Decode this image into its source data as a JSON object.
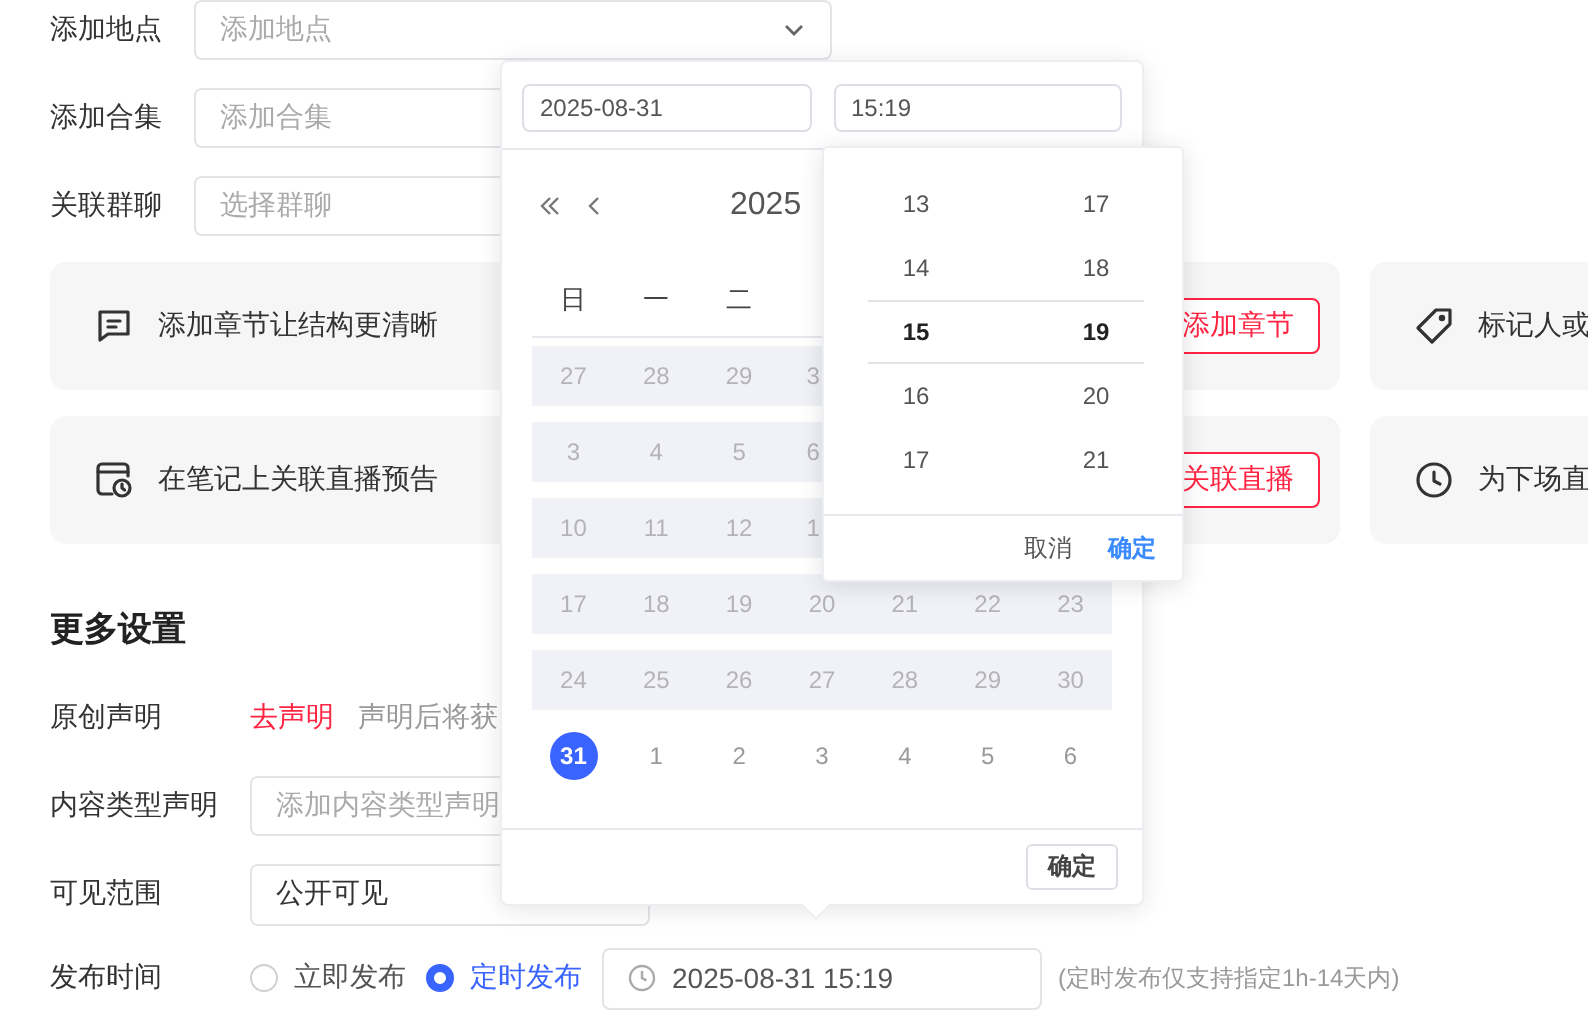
{
  "top_fields": [
    {
      "label": "添加地点",
      "placeholder": "添加地点",
      "kind": "select"
    },
    {
      "label": "添加合集",
      "placeholder": "添加合集",
      "kind": "input"
    },
    {
      "label": "关联群聊",
      "placeholder": "选择群聊",
      "kind": "input"
    }
  ],
  "feature_cards": [
    {
      "text": "添加章节让结构更清晰",
      "button": "添加章节"
    },
    {
      "text": "标记人或"
    },
    {
      "text": "在笔记上关联直播预告",
      "button": "关联直播"
    },
    {
      "text": "为下场直"
    }
  ],
  "more_settings": {
    "title": "更多设置",
    "original": {
      "label": "原创声明",
      "link": "去声明",
      "hint": "声明后将获"
    },
    "content_type": {
      "label": "内容类型声明",
      "placeholder": "添加内容类型声明"
    },
    "visibility": {
      "label": "可见范围",
      "value": "公开可见"
    },
    "publish": {
      "label": "发布时间",
      "options": [
        {
          "label": "立即发布",
          "selected": false
        },
        {
          "label": "定时发布",
          "selected": true
        }
      ],
      "value": "2025-08-31 15:19",
      "note": "(定时发布仅支持指定1h-14天内)"
    }
  },
  "date_popover": {
    "date_value": "2025-08-31",
    "time_value": "15:19",
    "month_title": "2025",
    "weekdays": [
      "日",
      "一",
      "二"
    ],
    "weeks": [
      {
        "disabled": true,
        "days": [
          {
            "label": "27",
            "selected": false
          },
          {
            "label": "28",
            "selected": false
          },
          {
            "label": "29",
            "selected": false
          },
          {
            "label": "3",
            "selected": false
          }
        ]
      },
      {
        "disabled": true,
        "days": [
          {
            "label": "3",
            "selected": false
          },
          {
            "label": "4",
            "selected": false
          },
          {
            "label": "5",
            "selected": false
          },
          {
            "label": "6",
            "selected": false
          }
        ]
      },
      {
        "disabled": true,
        "days": [
          {
            "label": "10",
            "selected": false
          },
          {
            "label": "11",
            "selected": false
          },
          {
            "label": "12",
            "selected": false
          },
          {
            "label": "1",
            "selected": false
          }
        ]
      },
      {
        "disabled": true,
        "days": [
          {
            "label": "17",
            "selected": false
          },
          {
            "label": "18",
            "selected": false
          },
          {
            "label": "19",
            "selected": false
          },
          {
            "label": "20",
            "selected": false
          },
          {
            "label": "21",
            "selected": false
          },
          {
            "label": "22",
            "selected": false
          },
          {
            "label": "23",
            "selected": false
          }
        ]
      },
      {
        "disabled": true,
        "days": [
          {
            "label": "24",
            "selected": false
          },
          {
            "label": "25",
            "selected": false
          },
          {
            "label": "26",
            "selected": false
          },
          {
            "label": "27",
            "selected": false
          },
          {
            "label": "28",
            "selected": false
          },
          {
            "label": "29",
            "selected": false
          },
          {
            "label": "30",
            "selected": false
          }
        ]
      },
      {
        "disabled": false,
        "days": [
          {
            "label": "31",
            "selected": true
          },
          {
            "label": "1",
            "selected": false
          },
          {
            "label": "2",
            "selected": false
          },
          {
            "label": "3",
            "selected": false
          },
          {
            "label": "4",
            "selected": false
          },
          {
            "label": "5",
            "selected": false
          },
          {
            "label": "6",
            "selected": false
          }
        ]
      }
    ],
    "confirm": "确定"
  },
  "time_picker": {
    "hours": [
      {
        "label": "13",
        "selected": false
      },
      {
        "label": "14",
        "selected": false
      },
      {
        "label": "15",
        "selected": true
      },
      {
        "label": "16",
        "selected": false
      },
      {
        "label": "17",
        "selected": false
      }
    ],
    "minutes": [
      {
        "label": "17",
        "selected": false
      },
      {
        "label": "18",
        "selected": false
      },
      {
        "label": "19",
        "selected": true
      },
      {
        "label": "20",
        "selected": false
      },
      {
        "label": "21",
        "selected": false
      }
    ],
    "cancel": "取消",
    "confirm": "确定"
  }
}
